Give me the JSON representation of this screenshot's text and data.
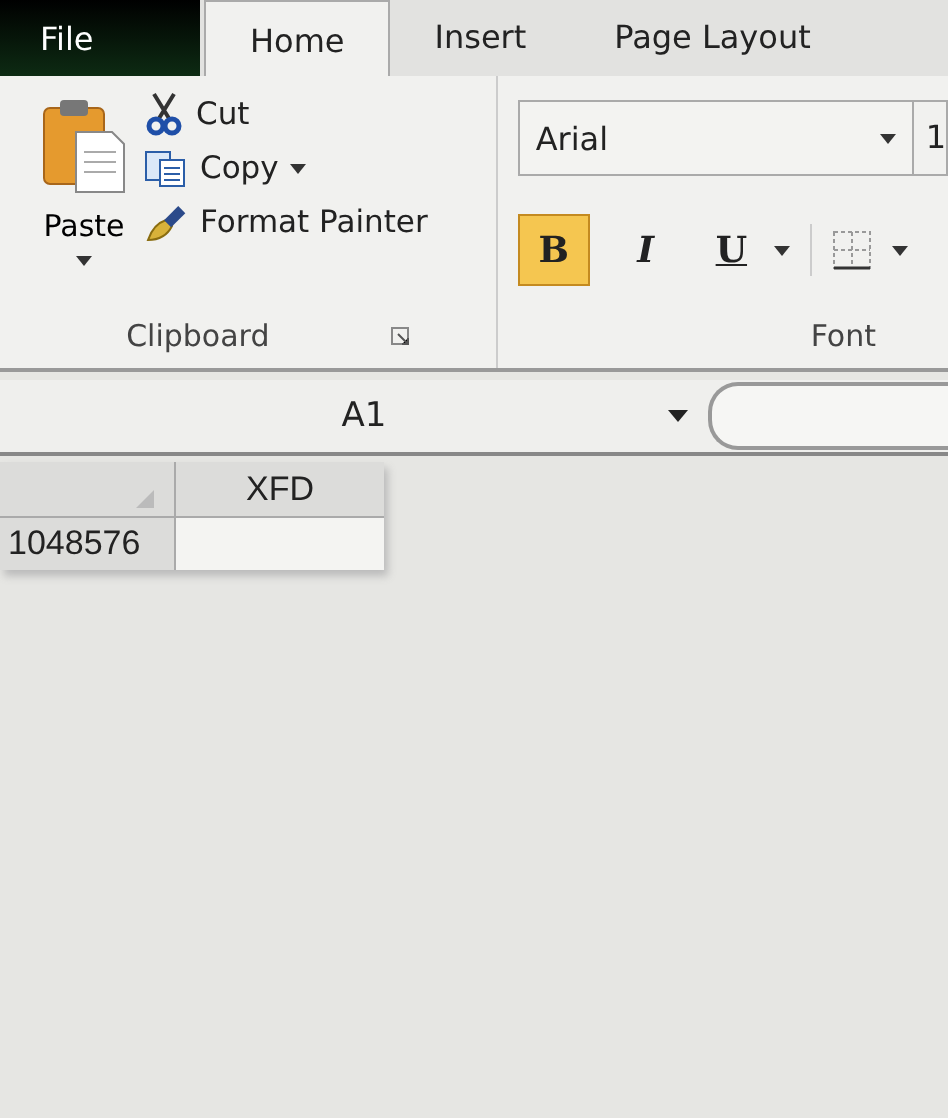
{
  "tabs": [
    {
      "label": "File",
      "kind": "file",
      "selected": false
    },
    {
      "label": "Home",
      "kind": "tab",
      "selected": true
    },
    {
      "label": "Insert",
      "kind": "tab",
      "selected": false
    },
    {
      "label": "Page Layout",
      "kind": "tab",
      "selected": false
    }
  ],
  "clipboard": {
    "paste": "Paste",
    "cut": "Cut",
    "copy": "Copy",
    "format_painter": "Format Painter",
    "group_label": "Clipboard"
  },
  "font": {
    "name": "Arial",
    "size": "1",
    "group_label": "Font",
    "styles": [
      {
        "label": "B",
        "kind": "bold",
        "selected": true
      },
      {
        "label": "I",
        "kind": "italic",
        "selected": false
      },
      {
        "label": "U",
        "kind": "underline",
        "selected": false
      }
    ]
  },
  "name_box": "A1",
  "grid": {
    "column": "XFD",
    "row": "1048576"
  }
}
